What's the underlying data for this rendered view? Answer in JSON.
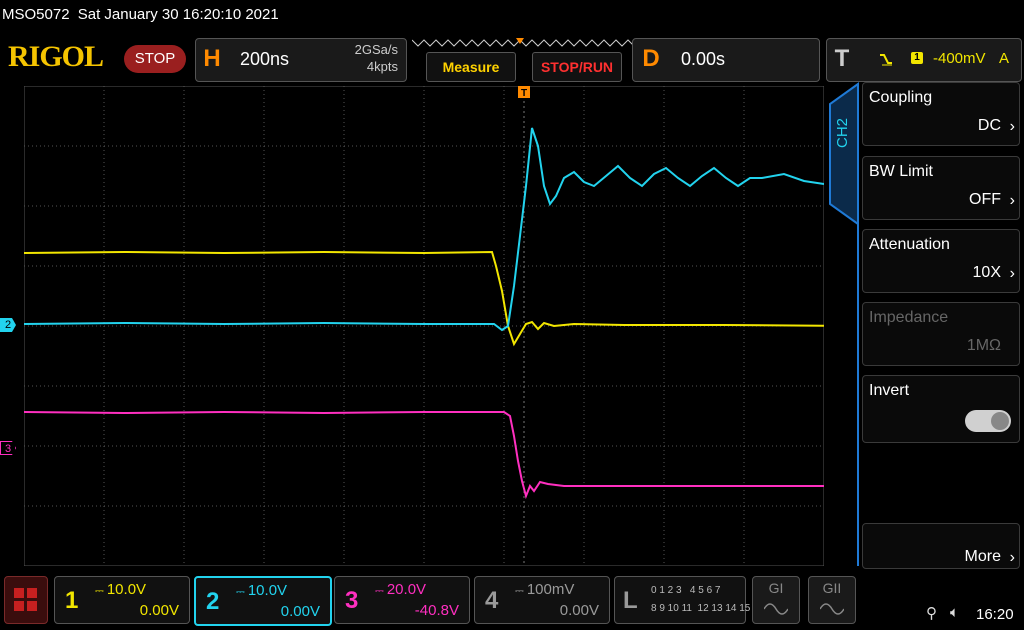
{
  "status": {
    "model": "MSO5072",
    "datetime": "Sat January 30 16:20:10 2021"
  },
  "brand": {
    "logo": "RIGOL",
    "state": "STOP"
  },
  "horizontal": {
    "letter": "H",
    "timebase": "200ns",
    "sample_rate": "2GSa/s",
    "memory": "4kpts"
  },
  "buttons": {
    "measure": "Measure",
    "stop_run": "STOP/RUN"
  },
  "delay": {
    "letter": "D",
    "value": "0.00s"
  },
  "trigger": {
    "letter": "T",
    "source": "1",
    "level": "-400mV",
    "mode": "A"
  },
  "side_menu": {
    "channel_tab": "CH2",
    "items": [
      {
        "title": "Coupling",
        "value": "DC"
      },
      {
        "title": "BW Limit",
        "value": "OFF"
      },
      {
        "title": "Attenuation",
        "value": "10X"
      },
      {
        "title": "Impedance",
        "value": "1MΩ"
      },
      {
        "title": "Invert",
        "value": ""
      },
      {
        "title": "",
        "value": "More"
      }
    ]
  },
  "channels": [
    {
      "num": "1",
      "scale": "10.0V",
      "offset": "0.00V",
      "color": "#f2e600"
    },
    {
      "num": "2",
      "scale": "10.0V",
      "offset": "0.00V",
      "color": "#22d3ee"
    },
    {
      "num": "3",
      "scale": "20.0V",
      "offset": "-40.8V",
      "color": "#ff2fc0"
    },
    {
      "num": "4",
      "scale": "100mV",
      "offset": "0.00V",
      "color": "#9a9a9a"
    }
  ],
  "la_digits": {
    "letter": "L",
    "row1": "0 1 2 3   4 5 6 7",
    "row2": "8 9 10 11  12 13 14 15"
  },
  "generators": [
    "GI",
    "GII"
  ],
  "clock": "16:20",
  "markers": {
    "ch2": "2",
    "ch3": "3"
  }
}
